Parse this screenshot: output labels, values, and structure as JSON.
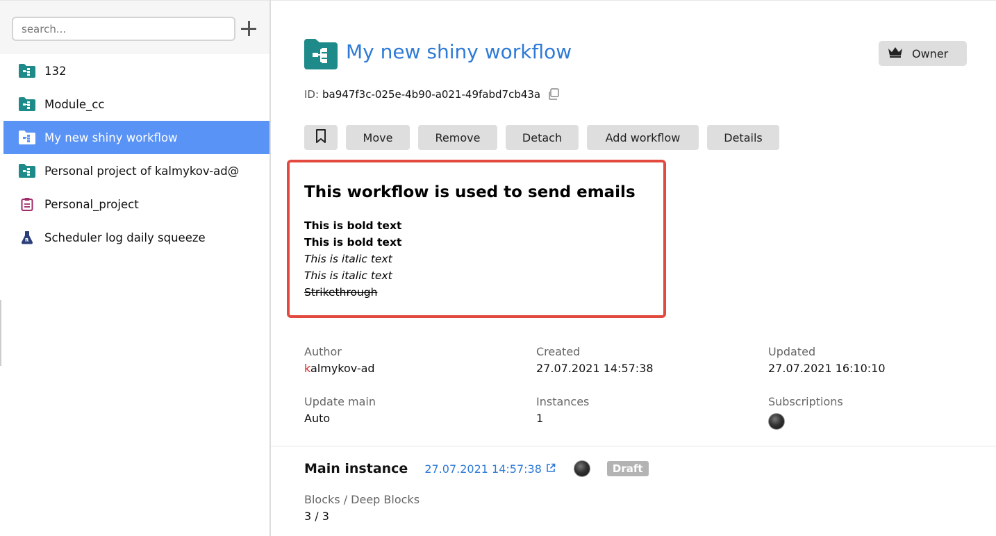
{
  "search": {
    "placeholder": "search..."
  },
  "tree": [
    {
      "label": "132",
      "icon": "workflow-folder-icon"
    },
    {
      "label": "Module_cc",
      "icon": "workflow-folder-icon"
    },
    {
      "label": "My new shiny workflow",
      "icon": "workflow-folder-icon",
      "active": true
    },
    {
      "label": "Personal project of kalmykov-ad@",
      "icon": "workflow-folder-icon"
    },
    {
      "label": "Personal_project",
      "icon": "clipboard-icon"
    },
    {
      "label": "Scheduler log daily squeeze",
      "icon": "flask-icon"
    }
  ],
  "header": {
    "title": "My new shiny workflow",
    "owner_label": "Owner",
    "id_label": "ID:",
    "id_value": "ba947f3c-025e-4b90-a021-49fabd7cb43a"
  },
  "toolbar": {
    "move": "Move",
    "remove": "Remove",
    "detach": "Detach",
    "add_workflow": "Add workflow",
    "details": "Details"
  },
  "description": {
    "title": "This workflow is used to send emails",
    "bold1": "This is bold text",
    "bold2": "This is bold text",
    "italic1": "This is italic text",
    "italic2": "This is italic text",
    "strike": "Strikethrough"
  },
  "meta": {
    "author_label": "Author",
    "author_first": "k",
    "author_rest": "almykov-ad",
    "created_label": "Created",
    "created_value": "27.07.2021 14:57:38",
    "updated_label": "Updated",
    "updated_value": "27.07.2021 16:10:10",
    "update_main_label": "Update main",
    "update_main_value": "Auto",
    "instances_label": "Instances",
    "instances_value": "1",
    "subscriptions_label": "Subscriptions"
  },
  "main_instance": {
    "title": "Main instance",
    "link": "27.07.2021 14:57:38",
    "badge": "Draft",
    "blocks_label": "Blocks / Deep Blocks",
    "blocks_value": "3 / 3"
  },
  "colors": {
    "accent": "#2e7ad6",
    "active_item": "#5a93f6",
    "workflow_icon": "#1f8a8a",
    "highlight_border": "#e24a40"
  }
}
